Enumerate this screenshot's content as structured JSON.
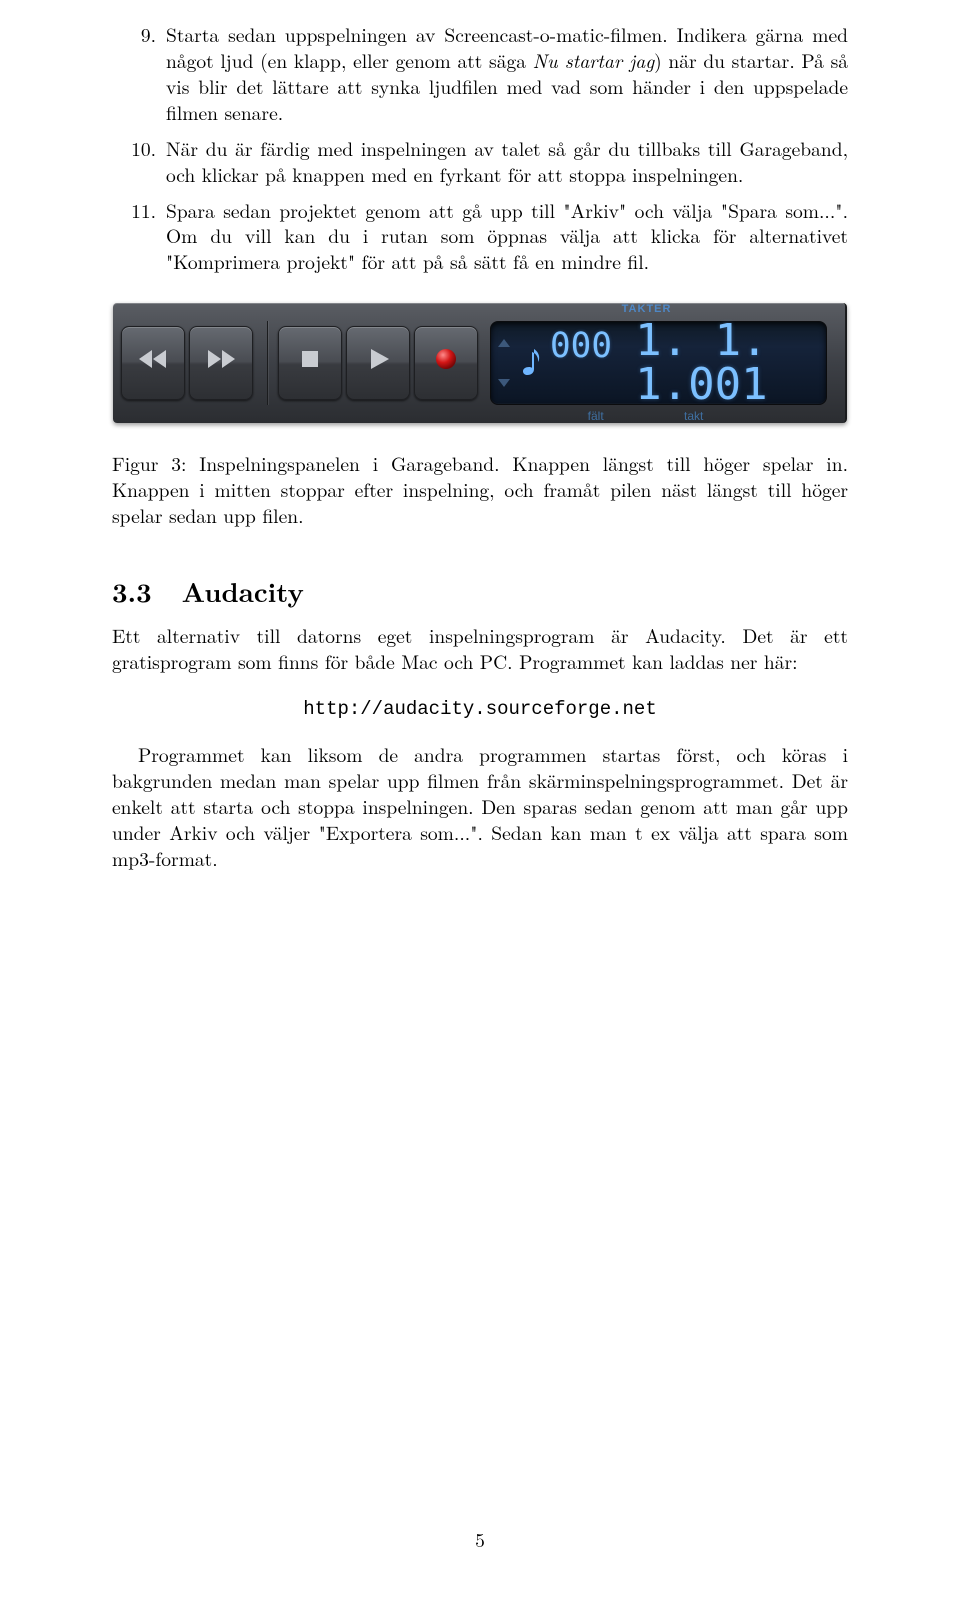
{
  "list": {
    "items": [
      {
        "num": "9.",
        "text_a": "Starta sedan uppspelningen av Screencast-o-matic-filmen. Indikera gärna med något ljud (en klapp, eller genom att säga ",
        "em": "Nu startar jag",
        "text_b": ") när du startar. På så vis blir det lättare att synka ljudfilen med vad som händer i den uppspelade filmen senare."
      },
      {
        "num": "10.",
        "text_a": "När du är färdig med inspelningen av talet så går du tillbaks till Garageband, och klickar på knappen med en fyrkant för att stoppa inspelningen.",
        "em": "",
        "text_b": ""
      },
      {
        "num": "11.",
        "text_a": "Spara sedan projektet genom att gå upp till \"Arkiv\" och välja \"Spara som...\". Om du vill kan du i rutan som öppnas välja att klicka för alternativet \"Komprimera projekt\" för att på så sätt få en mindre fil.",
        "em": "",
        "text_b": ""
      }
    ]
  },
  "garageband": {
    "lcd_title": "TAKTER",
    "field1_digits": "000",
    "big_digits": "1. 1. 1.001",
    "footer_left": "fält",
    "footer_right": "takt"
  },
  "caption": "Figur 3: Inspelningspanelen i Garageband. Knappen längst till höger spelar in. Knappen i mitten stoppar efter inspelning, och framåt pilen näst längst till höger spelar sedan upp filen.",
  "section": {
    "num": "3.3",
    "title": "Audacity"
  },
  "audacity": {
    "p1": "Ett alternativ till datorns eget inspelningsprogram är Audacity. Det är ett gratisprogram som finns för både Mac och PC. Programmet kan laddas ner här:",
    "url": "http://audacity.sourceforge.net",
    "p2": "Programmet kan liksom de andra programmen startas först, och köras i bakgrunden medan man spelar upp filmen från skärminspelningsprogrammet. Det är enkelt att starta och stoppa inspelningen. Den sparas sedan genom att man går upp under Arkiv och väljer \"Exportera som...\". Sedan kan man t ex välja att spara som mp3-format."
  },
  "page_number": "5"
}
